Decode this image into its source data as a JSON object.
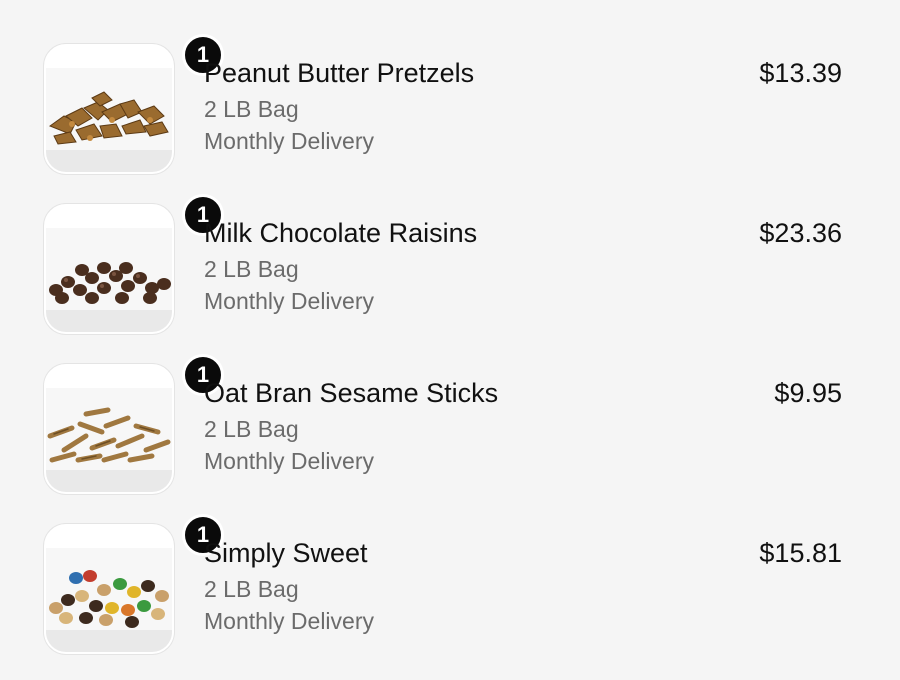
{
  "items": [
    {
      "quantity": "1",
      "name": "Peanut Butter Pretzels",
      "size": "2 LB Bag",
      "plan": "Monthly Delivery",
      "price": "$13.39",
      "image": "peanut-butter-pretzels-image"
    },
    {
      "quantity": "1",
      "name": "Milk Chocolate Raisins",
      "size": "2 LB Bag",
      "plan": "Monthly Delivery",
      "price": "$23.36",
      "image": "milk-chocolate-raisins-image"
    },
    {
      "quantity": "1",
      "name": "Oat Bran Sesame Sticks",
      "size": "2 LB Bag",
      "plan": "Monthly Delivery",
      "price": "$9.95",
      "image": "oat-bran-sesame-sticks-image"
    },
    {
      "quantity": "1",
      "name": "Simply Sweet",
      "size": "2 LB Bag",
      "plan": "Monthly Delivery",
      "price": "$15.81",
      "image": "simply-sweet-trail-mix-image"
    }
  ]
}
